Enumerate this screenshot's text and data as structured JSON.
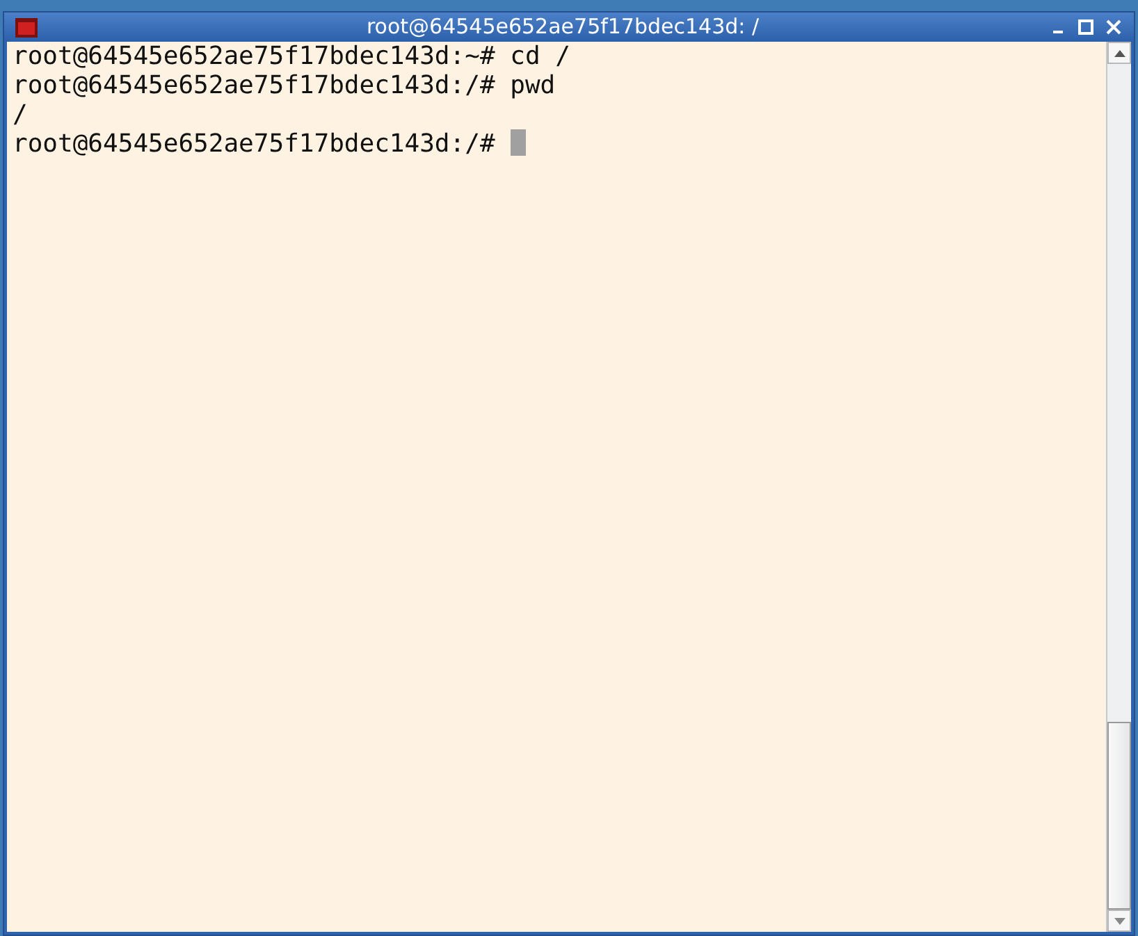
{
  "window": {
    "title": "root@64545e652ae75f17bdec143d: /"
  },
  "terminal": {
    "lines": [
      {
        "text": "root@64545e652ae75f17bdec143d:~# cd /"
      },
      {
        "text": "root@64545e652ae75f17bdec143d:/# pwd"
      },
      {
        "text": "/"
      },
      {
        "text": "root@64545e652ae75f17bdec143d:/# ",
        "cursor": true
      }
    ]
  }
}
